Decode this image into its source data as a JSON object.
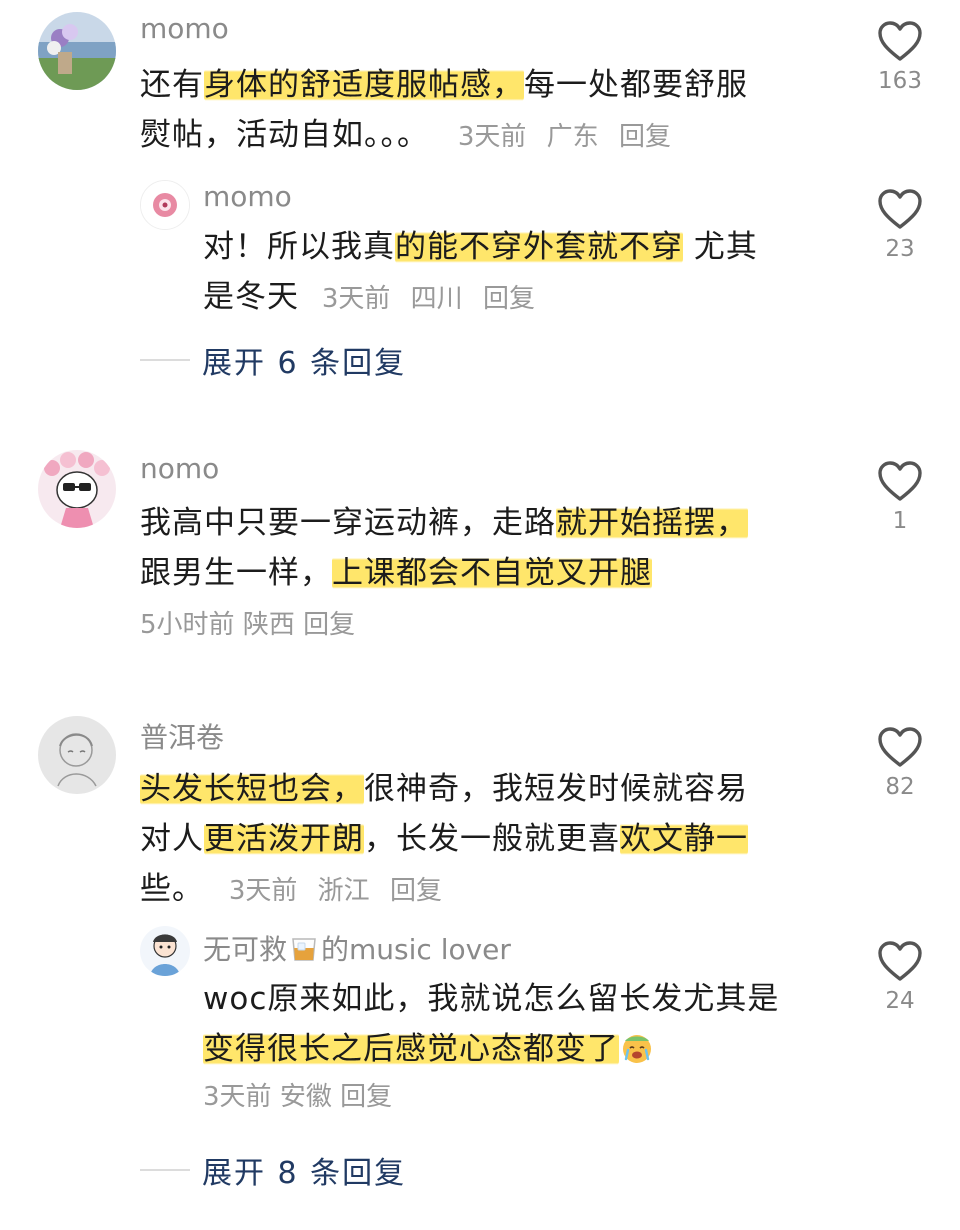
{
  "comments": [
    {
      "username": "momo",
      "text_lines": [
        [
          {
            "t": "还有"
          },
          {
            "t": "身体的舒适度服帖感，",
            "hl": true
          },
          {
            "t": "每一处都要舒服"
          }
        ],
        [
          {
            "t": "熨帖，活动自如。。。"
          }
        ]
      ],
      "time": "3天前",
      "location": "广东",
      "reply_label": "回复",
      "likes": "163",
      "replies": [
        {
          "username": "momo",
          "text_lines": [
            [
              {
                "t": "对！所以我真"
              },
              {
                "t": "的能不穿外套就不穿",
                "hl": true
              },
              {
                "t": " 尤其"
              }
            ],
            [
              {
                "t": "是冬天"
              }
            ]
          ],
          "time": "3天前",
          "location": "四川",
          "reply_label": "回复",
          "likes": "23"
        }
      ],
      "expand_label": "展开 6 条回复"
    },
    {
      "username": "nomo",
      "text_lines": [
        [
          {
            "t": "我高中只要一穿运动裤，走路"
          },
          {
            "t": "就开始摇摆，",
            "hl": true
          }
        ],
        [
          {
            "t": "跟男生一样，"
          },
          {
            "t": "上课都会不自觉叉开腿",
            "hl": true
          }
        ]
      ],
      "time": "5小时前",
      "location": "陕西",
      "reply_label": "回复",
      "likes": "1"
    },
    {
      "username": "普洱卷",
      "text_lines": [
        [
          {
            "t": "头发长短也会，",
            "hl": true
          },
          {
            "t": "很神奇，我短发时候就容易"
          }
        ],
        [
          {
            "t": "对人"
          },
          {
            "t": "更活泼开朗",
            "hl": true
          },
          {
            "t": "，长发一般就更喜"
          },
          {
            "t": "欢文静一",
            "hl": true
          }
        ],
        [
          {
            "t": "些。"
          }
        ]
      ],
      "time": "3天前",
      "location": "浙江",
      "reply_label": "回复",
      "likes": "82",
      "replies": [
        {
          "username_prefix": "无可救",
          "username_icon": "whisky-glass-emoji",
          "username_suffix": "的music lover",
          "text_lines": [
            [
              {
                "t": "woc原来如此，我就说怎么留长发尤其是"
              }
            ],
            [
              {
                "t": "变得很长之后感觉心态都变了",
                "hl": true
              }
            ]
          ],
          "text_emoji": "crying-face-emoji",
          "time": "3天前",
          "location": "安徽",
          "reply_label": "回复",
          "likes": "24"
        }
      ],
      "expand_label": "展开 8 条回复"
    }
  ],
  "colors": {
    "highlight": "#ffe66b",
    "expand_text": "#213a63",
    "meta": "#999999",
    "username": "#8a8a8a"
  }
}
